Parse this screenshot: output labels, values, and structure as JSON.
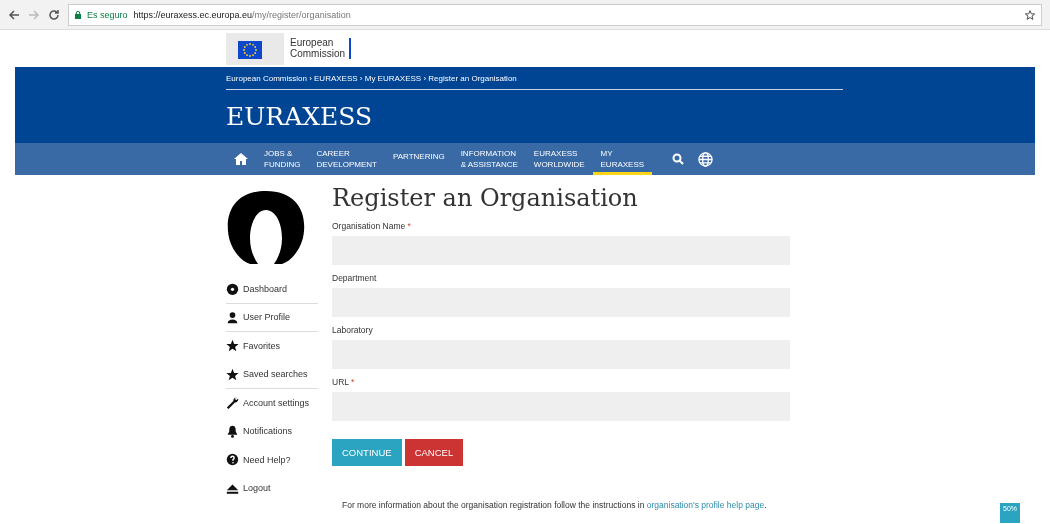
{
  "browser": {
    "secure_label": "Es seguro",
    "url_host": "https://euraxess.ec.europa.eu",
    "url_path": "/my/register/organisation"
  },
  "logo": {
    "line_1": "European",
    "line_2": "Commission"
  },
  "breadcrumb": "European Commission › EURAXESS › My EURAXESS › Register an Organisation",
  "site_title": "EURAXESS",
  "nav": [
    {
      "line_1": "JOBS &",
      "line_2": "FUNDING",
      "selected": false
    },
    {
      "line_1": "CAREER",
      "line_2": "DEVELOPMENT",
      "selected": false
    },
    {
      "line_1": "PARTNERING",
      "selected": false
    },
    {
      "line_1": "INFORMATION",
      "line_2": "& ASSISTANCE",
      "selected": false
    },
    {
      "line_1": "EURAXESS",
      "line_2": "WORLDWIDE",
      "selected": false
    },
    {
      "line_1": "MY",
      "line_2": "EURAXESS",
      "selected": true
    }
  ],
  "sidebar": {
    "items": [
      {
        "label": "Dashboard",
        "kind": "dashboard",
        "separated": true
      },
      {
        "label": "User Profile",
        "kind": "user",
        "separated": true
      },
      {
        "label": "Favorites",
        "kind": "star"
      },
      {
        "label": "Saved searches",
        "kind": "star",
        "separated": true
      },
      {
        "label": "Account settings",
        "kind": "wrench"
      },
      {
        "label": "Notifications",
        "kind": "bell"
      },
      {
        "label": "Need Help?",
        "kind": "help"
      },
      {
        "label": "Logout",
        "kind": "eject"
      }
    ]
  },
  "page_title": "Register an Organisation",
  "fields": [
    {
      "label": "Organisation Name",
      "required_mark": "*"
    },
    {
      "label": "Department"
    },
    {
      "label": "Laboratory"
    },
    {
      "label": "URL",
      "required_mark": "*"
    }
  ],
  "buttons": [
    {
      "label": "CONTINUE",
      "kind": "primary"
    },
    {
      "label": "CANCEL",
      "kind": "danger"
    }
  ],
  "info": {
    "text": "For more information about the organisation registration follow the instructions in ",
    "link": "organisation's profile help page",
    "after": "."
  },
  "zoom_badge": "50%"
}
